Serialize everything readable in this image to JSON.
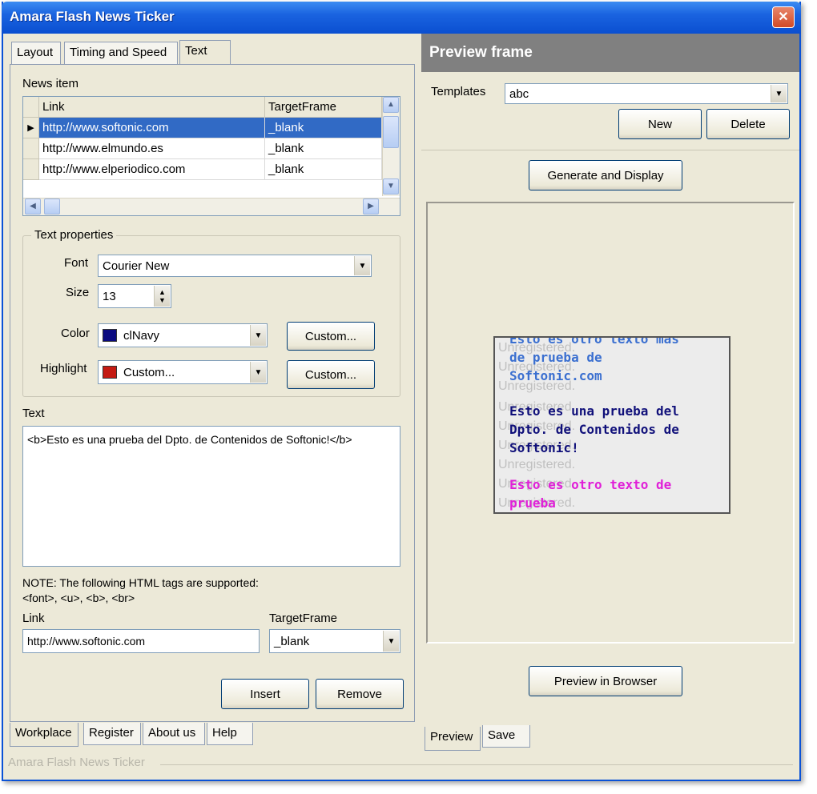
{
  "window": {
    "title": "Amara Flash News Ticker",
    "close_glyph": "✕"
  },
  "tabs_top": [
    "Layout",
    "Timing and Speed",
    "Text"
  ],
  "news_item": {
    "group_label": "News item",
    "columns": [
      "Link",
      "TargetFrame"
    ],
    "rows": [
      {
        "link": "http://www.softonic.com",
        "target": "_blank"
      },
      {
        "link": "http://www.elmundo.es",
        "target": "_blank"
      },
      {
        "link": "http://www.elperiodico.com",
        "target": "_blank"
      }
    ]
  },
  "text_properties": {
    "group_label": "Text properties",
    "font_label": "Font",
    "font_value": "Courier New",
    "size_label": "Size",
    "size_value": "13",
    "color_label": "Color",
    "color_value": "clNavy",
    "color_swatch": "#0a0a80",
    "highlight_label": "Highlight",
    "highlight_value": "Custom...",
    "highlight_swatch": "#c41a12",
    "custom_button": "Custom..."
  },
  "text_section": {
    "label": "Text",
    "content": "<b>Esto es una prueba del Dpto. de Contenidos de Softonic!</b>",
    "note_line1": "NOTE: The following HTML tags are supported:",
    "note_line2": "<font>, <u>, <b>, <br>"
  },
  "link_section": {
    "link_label": "Link",
    "link_value": "http://www.softonic.com",
    "target_label": "TargetFrame",
    "target_value": "_blank"
  },
  "buttons": {
    "insert": "Insert",
    "remove": "Remove",
    "new": "New",
    "delete": "Delete",
    "generate": "Generate and Display",
    "preview_browser": "Preview in Browser"
  },
  "tabs_bottom_left": [
    "Workplace",
    "Register",
    "About us",
    "Help"
  ],
  "status_text": "Amara Flash News Ticker",
  "preview": {
    "header": "Preview frame",
    "templates_label": "Templates",
    "templates_value": "abc",
    "tabs_bottom": [
      "Preview",
      "Save"
    ],
    "ticker": {
      "watermark": "Unregistered.",
      "line1": "Esto es otro texto mas",
      "line2": "de prueba de",
      "line3": "Softonic.com",
      "line4": "Esto es una prueba del",
      "line5": "Dpto. de Contenidos de",
      "line6": "Softonic!",
      "line7": "Esto es otro texto de",
      "line8": "prueba",
      "color_blue": "#3a6fd0",
      "color_navy": "#10107a",
      "color_magenta": "#e020d8"
    }
  }
}
